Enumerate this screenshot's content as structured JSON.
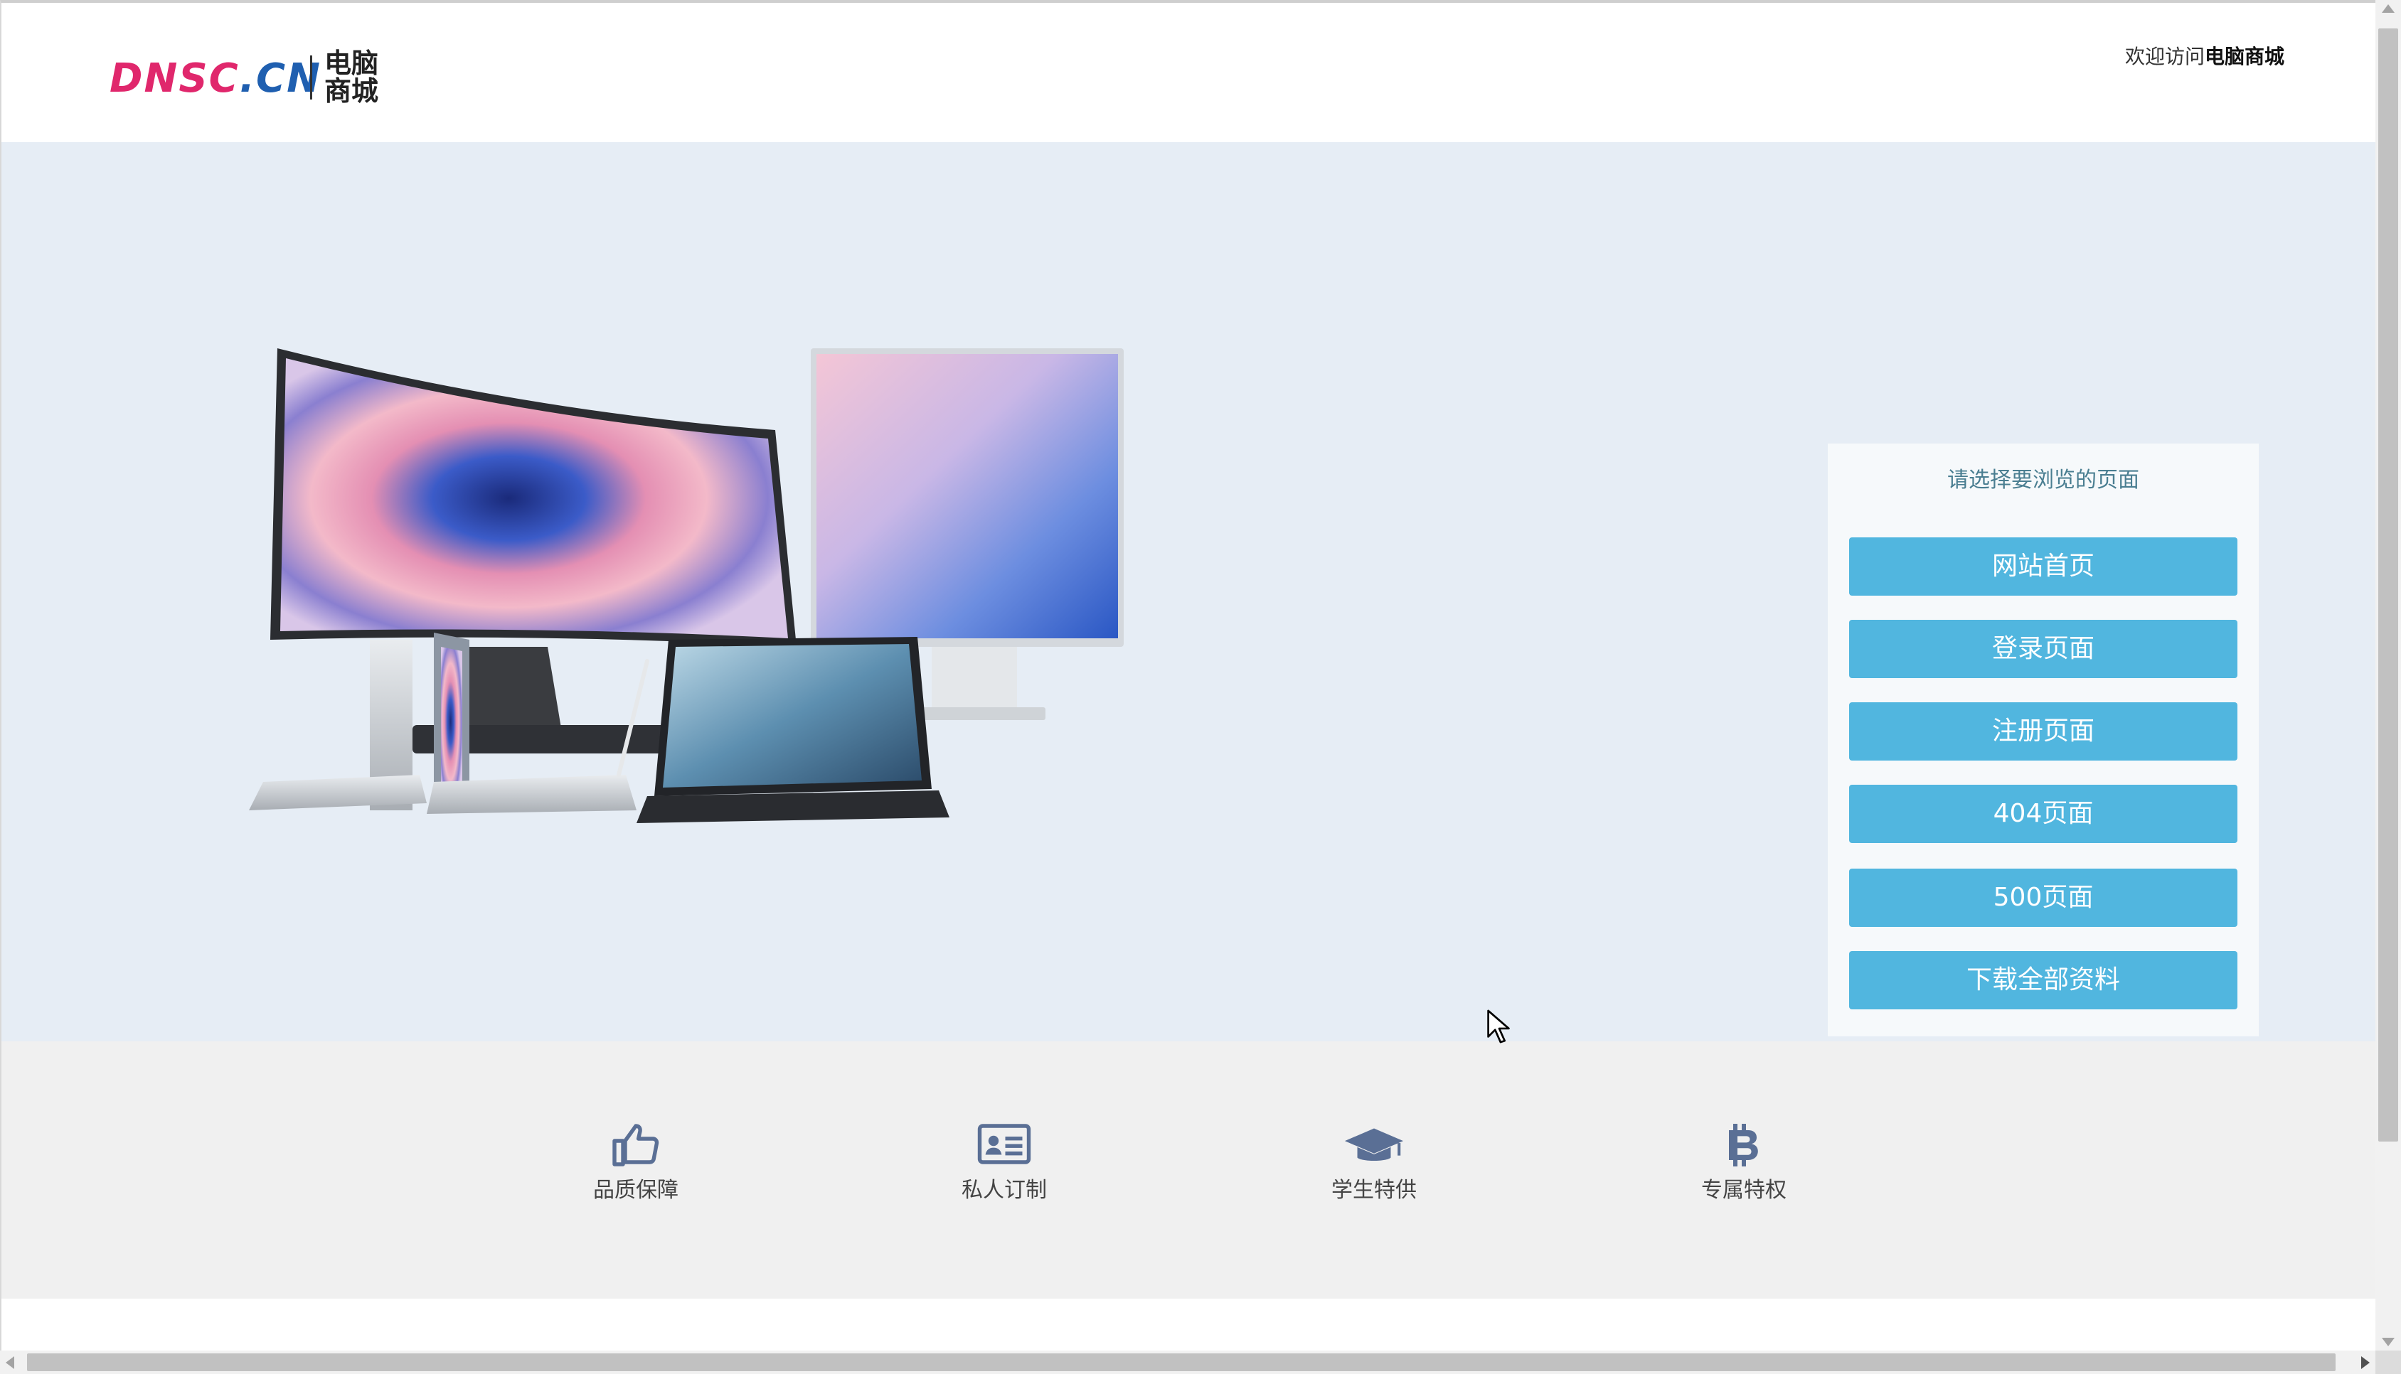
{
  "header": {
    "logo_latin": "DNSC.CN",
    "logo_cn_line1": "电脑",
    "logo_cn_line2": "商城",
    "welcome_prefix": "欢迎访问",
    "welcome_site": "电脑商城"
  },
  "colors": {
    "hero_bg": "#e6edf5",
    "button_bg": "#51b6df",
    "logo_pink": "#e0276c",
    "logo_blue": "#1f5fb0",
    "feature_icon": "#5a6f95"
  },
  "panel": {
    "title": "请选择要浏览的页面",
    "buttons": [
      "网站首页",
      "登录页面",
      "注册页面",
      "404页面",
      "500页面",
      "下载全部资料"
    ]
  },
  "features": [
    {
      "label": "品质保障",
      "icon": "thumbs-up-icon"
    },
    {
      "label": "私人订制",
      "icon": "id-card-icon"
    },
    {
      "label": "学生特供",
      "icon": "graduation-cap-icon"
    },
    {
      "label": "专属特权",
      "icon": "bitcoin-icon"
    }
  ],
  "hero_image": {
    "icon": "product-devices-image"
  }
}
